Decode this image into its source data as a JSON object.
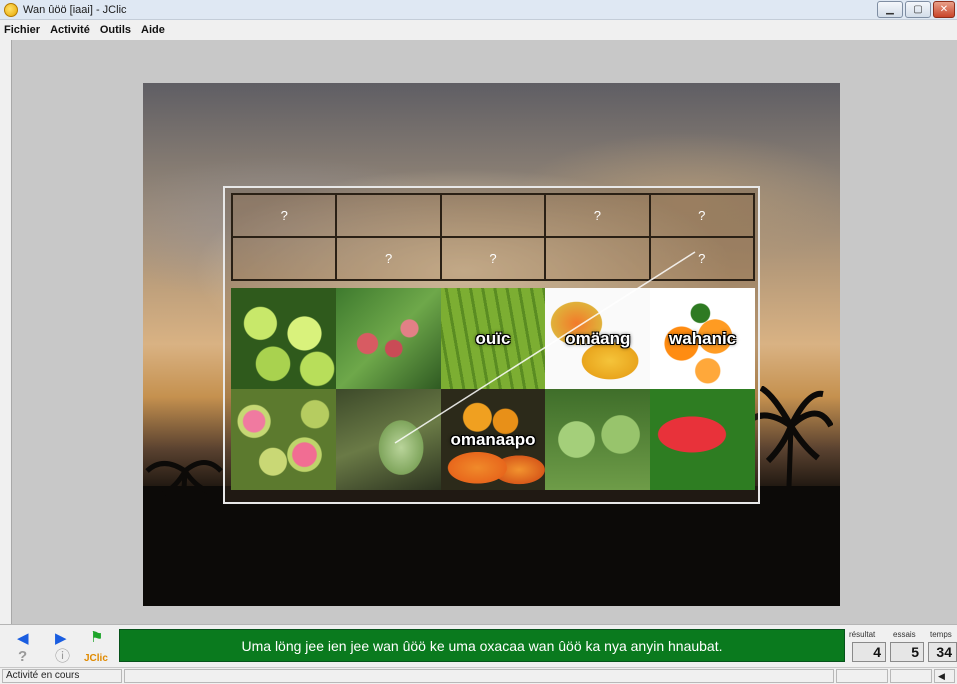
{
  "window": {
    "title": "Wan ûöö [iaai] - JClic"
  },
  "menu": [
    "Fichier",
    "Activité",
    "Outils",
    "Aide"
  ],
  "board": {
    "question_rows": [
      [
        "?",
        "",
        "",
        "?",
        "?"
      ],
      [
        "",
        "?",
        "?",
        "",
        "?"
      ]
    ],
    "pictures": [
      {
        "icon": "lime-photo",
        "label": ""
      },
      {
        "icon": "rose-apple-photo",
        "label": ""
      },
      {
        "icon": "banana-photo",
        "label": "ouïc"
      },
      {
        "icon": "mango-photo",
        "label": "omäang"
      },
      {
        "icon": "orange-photo",
        "label": "wahanic"
      },
      {
        "icon": "guava-photo",
        "label": ""
      },
      {
        "icon": "coconut-photo",
        "label": ""
      },
      {
        "icon": "papaya-photo",
        "label": "omanaapo"
      },
      {
        "icon": "sugar-apple-photo",
        "label": ""
      },
      {
        "icon": "watermelon-photo",
        "label": ""
      }
    ]
  },
  "footer": {
    "message": "Uma löng jee ien jee wan ûöö ke uma oxacaa wan ûöö ka nya anyin hnaubat.",
    "brand": "JClic",
    "counters": {
      "resultat_label": "résultat",
      "resultat": "4",
      "essais_label": "essais",
      "essais": "5",
      "temps_label": "temps",
      "temps": "34"
    }
  },
  "status": {
    "text": "Activité en cours"
  },
  "colors": {
    "message_bg": "#0a7a1e",
    "nav_arrow": "#1a5de0"
  }
}
